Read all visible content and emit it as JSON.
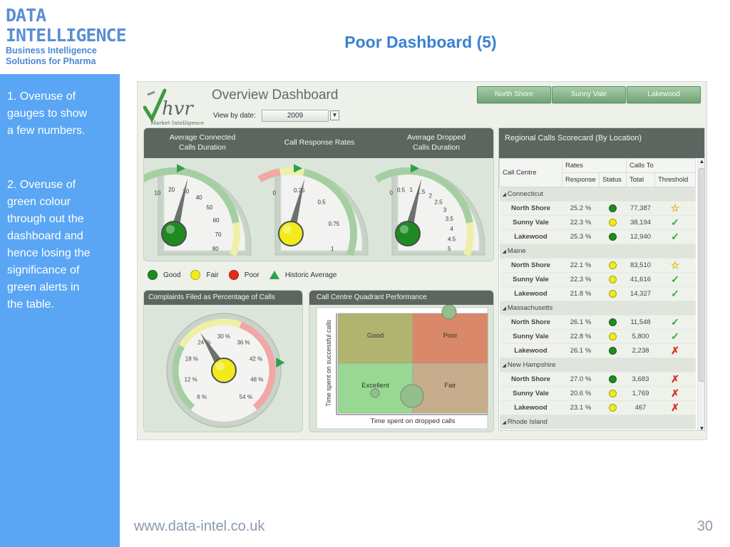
{
  "logo": {
    "line1": "DATA",
    "line2": "INTELLIGENCE",
    "tagline1": "Business Intelligence",
    "tagline2": "Solutions for Pharma"
  },
  "slide_title": "Poor Dashboard (5)",
  "notes": [
    "1. Overuse of\ngauges to show\na few numbers.",
    "2. Overuse of\ngreen colour\nthrough out the\ndashboard and\nhence losing the\nsignificance of\ngreen alerts in\nthe table."
  ],
  "footer": {
    "url": "www.data-intel.co.uk",
    "page": "30"
  },
  "dashboard": {
    "brand": "hvr",
    "brand_sub": "Market Intelligence",
    "title": "Overview Dashboard",
    "view_label": "View by date:",
    "year": "2009",
    "location_buttons": [
      "North Shore",
      "Sunny Vale",
      "Lakewood"
    ],
    "gauges": [
      {
        "title": "Average Connected\nCalls Duration",
        "ticks": [
          "10",
          "20",
          "30",
          "40",
          "50",
          "60",
          "70",
          "80"
        ],
        "status": "Good"
      },
      {
        "title": "Call Response Rates",
        "ticks": [
          "0",
          "0.25",
          "0.5",
          "0.75",
          "1"
        ],
        "status": "Fair"
      },
      {
        "title": "Average Dropped\nCalls Duration",
        "ticks": [
          "0",
          "0.5",
          "1",
          "1.5",
          "2",
          "2.5",
          "3",
          "3.5",
          "4",
          "4.5",
          "5"
        ],
        "status": "Good"
      }
    ],
    "legend": [
      {
        "label": "Good",
        "color": "#1f8a22"
      },
      {
        "label": "Fair",
        "color": "#f2ea1a"
      },
      {
        "label": "Poor",
        "color": "#e32a1e"
      },
      {
        "label": "Historic Average",
        "color": "#2f9f49"
      }
    ],
    "complaints": {
      "title": "Complaints Filed as Percentage of Calls",
      "ticks": [
        "6 %",
        "12 %",
        "18 %",
        "24 %",
        "30 %",
        "36 %",
        "42 %",
        "48 %",
        "54 %"
      ],
      "status": "Fair"
    },
    "quadrant": {
      "title": "Call Centre Quadrant Performance",
      "quadrants": [
        "Good",
        "Poor",
        "Excellent",
        "Fair"
      ],
      "y_label": "Time spent on successful calls",
      "x_label": "Time spent on dropped calls"
    },
    "scorecard": {
      "title": "Regional Calls Scorecard (By Location)",
      "group_rates": "Rates",
      "group_calls": "Calls To",
      "col_centre": "Call Centre",
      "cols": [
        "Response",
        "Status",
        "Total",
        "Threshold"
      ],
      "groups": [
        {
          "name": "Connecticut",
          "rows": [
            {
              "site": "North Shore",
              "response": "25.2 %",
              "status": "green",
              "total": "77,387",
              "threshold": "star"
            },
            {
              "site": "Sunny Vale",
              "response": "22.3 %",
              "status": "yellow",
              "total": "38,194",
              "threshold": "check"
            },
            {
              "site": "Lakewood",
              "response": "25.3 %",
              "status": "green",
              "total": "12,940",
              "threshold": "check"
            }
          ]
        },
        {
          "name": "Maine",
          "rows": [
            {
              "site": "North Shore",
              "response": "22.1 %",
              "status": "yellow",
              "total": "83,510",
              "threshold": "star"
            },
            {
              "site": "Sunny Vale",
              "response": "22.3 %",
              "status": "yellow",
              "total": "41,616",
              "threshold": "check"
            },
            {
              "site": "Lakewood",
              "response": "21.8 %",
              "status": "yellow",
              "total": "14,327",
              "threshold": "check"
            }
          ]
        },
        {
          "name": "Massachusetts",
          "rows": [
            {
              "site": "North Shore",
              "response": "26.1 %",
              "status": "green",
              "total": "11,548",
              "threshold": "check"
            },
            {
              "site": "Sunny Vale",
              "response": "22.8 %",
              "status": "yellow",
              "total": "5,800",
              "threshold": "check"
            },
            {
              "site": "Lakewood",
              "response": "26.1 %",
              "status": "green",
              "total": "2,238",
              "threshold": "cross"
            }
          ]
        },
        {
          "name": "New Hampshire",
          "rows": [
            {
              "site": "North Shore",
              "response": "27.0 %",
              "status": "green",
              "total": "3,683",
              "threshold": "cross"
            },
            {
              "site": "Sunny Vale",
              "response": "20.6 %",
              "status": "yellow",
              "total": "1,769",
              "threshold": "cross"
            },
            {
              "site": "Lakewood",
              "response": "23.1 %",
              "status": "yellow",
              "total": "467",
              "threshold": "cross"
            }
          ]
        },
        {
          "name": "Rhode Island",
          "rows": []
        }
      ]
    }
  },
  "colors": {
    "sidebar": "#5aa6f4",
    "title_blue": "#3a82d2",
    "header_dark": "#5d6560",
    "good": "#1f8a22",
    "fair": "#f2ea1a",
    "poor": "#e32a1e"
  }
}
